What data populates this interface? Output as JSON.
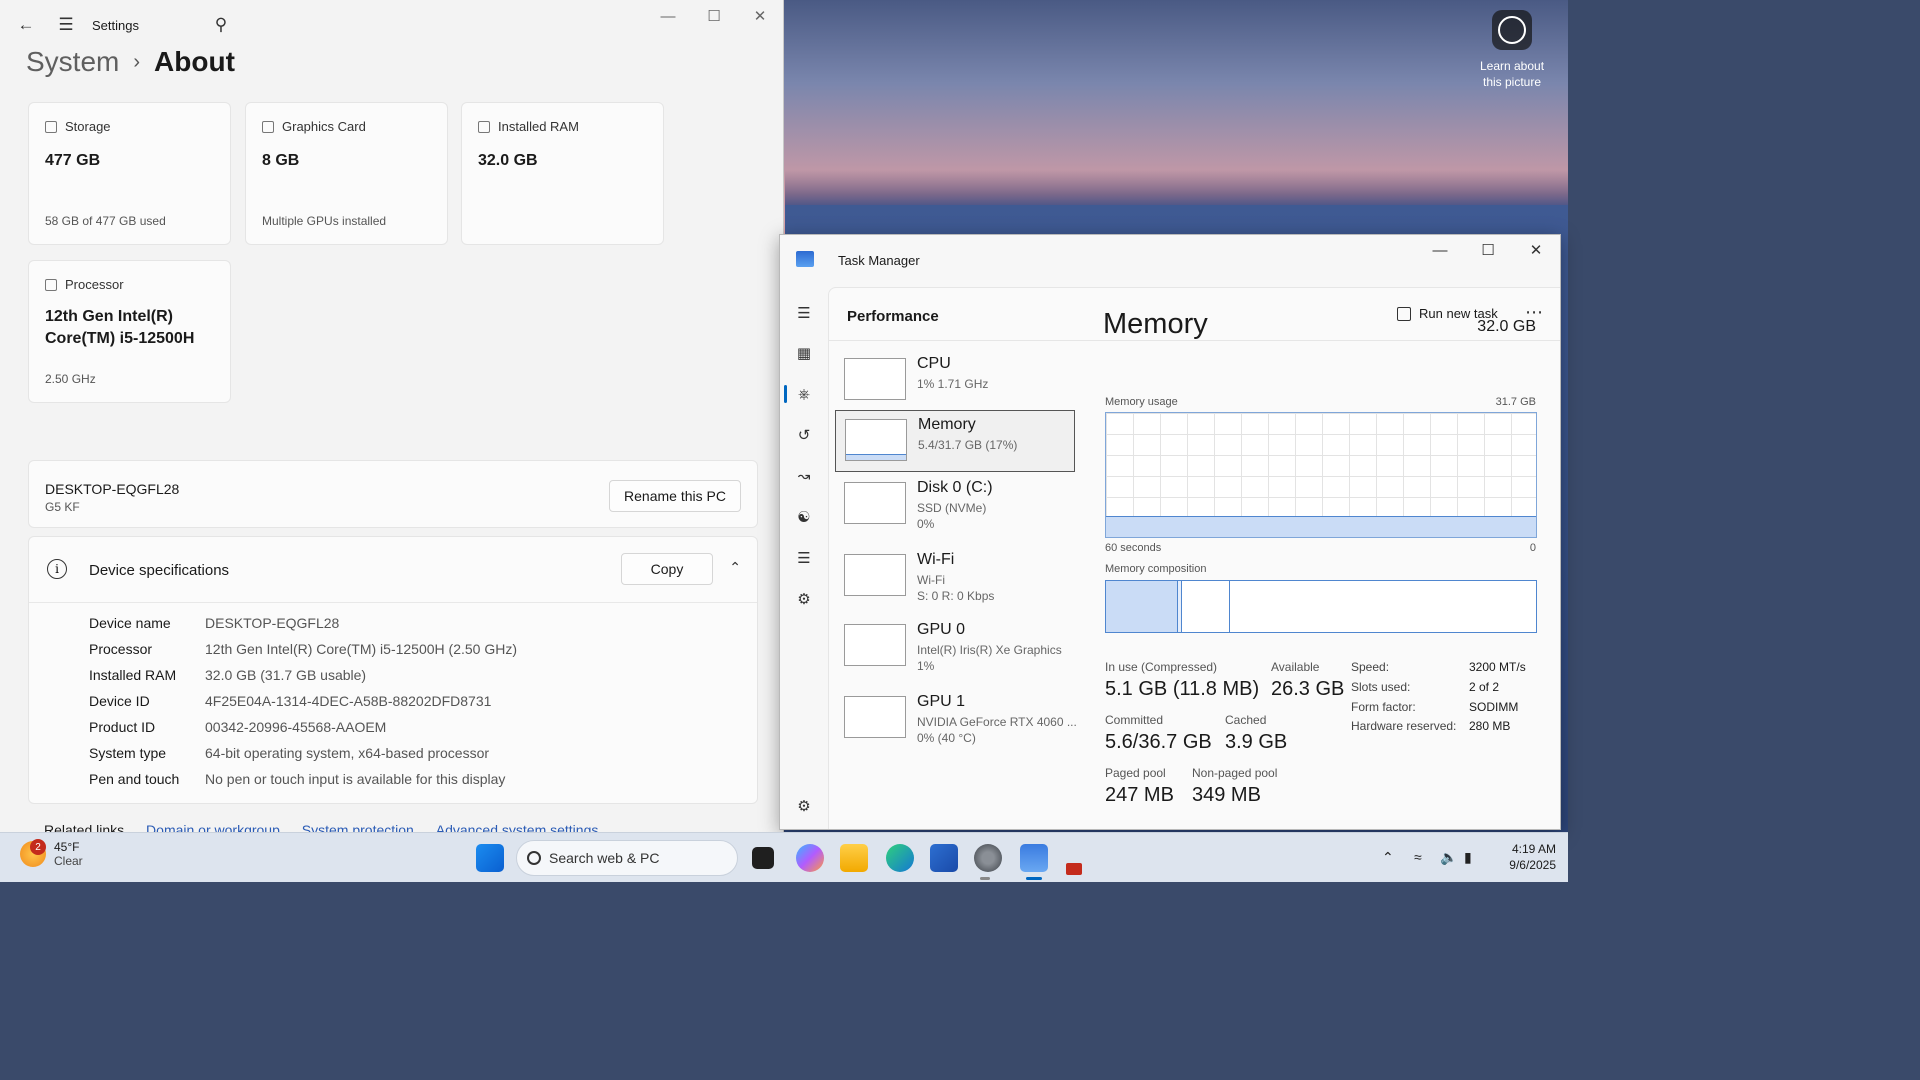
{
  "wallpaper": {
    "learn_line1": "Learn about",
    "learn_line2": "this picture"
  },
  "settings": {
    "title": "Settings",
    "breadcrumb": {
      "parent": "System",
      "current": "About"
    },
    "cards": {
      "storage": {
        "label": "Storage",
        "value": "477 GB",
        "sub": "58 GB of 477 GB used"
      },
      "graphics": {
        "label": "Graphics Card",
        "value": "8 GB",
        "sub": "Multiple GPUs installed"
      },
      "ram": {
        "label": "Installed RAM",
        "value": "32.0 GB"
      },
      "processor": {
        "label": "Processor",
        "value_line1": "12th Gen Intel(R)",
        "value_line2": "Core(TM) i5-12500H",
        "sub": "2.50 GHz"
      }
    },
    "pc": {
      "name": "DESKTOP-EQGFL28",
      "model": "G5 KF",
      "rename_label": "Rename this PC"
    },
    "specs": {
      "title": "Device specifications",
      "copy_label": "Copy",
      "rows": [
        {
          "k": "Device name",
          "v": "DESKTOP-EQGFL28"
        },
        {
          "k": "Processor",
          "v": "12th Gen Intel(R) Core(TM) i5-12500H (2.50 GHz)"
        },
        {
          "k": "Installed RAM",
          "v": "32.0 GB (31.7 GB usable)"
        },
        {
          "k": "Device ID",
          "v": "4F25E04A-1314-4DEC-A58B-88202DFD8731"
        },
        {
          "k": "Product ID",
          "v": "00342-20996-45568-AAOEM"
        },
        {
          "k": "System type",
          "v": "64-bit operating system, x64-based processor"
        },
        {
          "k": "Pen and touch",
          "v": "No pen or touch input is available for this display"
        }
      ]
    },
    "related": {
      "label": "Related links",
      "links": [
        "Domain or workgroup",
        "System protection",
        "Advanced system settings"
      ]
    }
  },
  "taskmgr": {
    "title": "Task Manager",
    "section": "Performance",
    "run_new_task": "Run new task",
    "resources": [
      {
        "name": "CPU",
        "l2": "1% 1.71 GHz",
        "l3": ""
      },
      {
        "name": "Memory",
        "l2": "5.4/31.7 GB (17%)",
        "l3": ""
      },
      {
        "name": "Disk 0 (C:)",
        "l2": "SSD (NVMe)",
        "l3": "0%"
      },
      {
        "name": "Wi-Fi",
        "l2": "Wi-Fi",
        "l3": "S: 0 R: 0 Kbps"
      },
      {
        "name": "GPU 0",
        "l2": "Intel(R) Iris(R) Xe Graphics",
        "l3": "1%"
      },
      {
        "name": "GPU 1",
        "l2": "NVIDIA GeForce RTX 4060 ...",
        "l3": "0% (40 °C)"
      }
    ],
    "memory": {
      "title": "Memory",
      "total": "32.0 GB",
      "usage_label": "Memory usage",
      "usage_max": "31.7 GB",
      "time_left": "60 seconds",
      "time_right": "0",
      "usage_fraction": 0.17,
      "composition_label": "Memory composition",
      "in_use_label": "In use (Compressed)",
      "in_use": "5.1 GB (11.8 MB)",
      "available_label": "Available",
      "available": "26.3 GB",
      "committed_label": "Committed",
      "committed": "5.6/36.7 GB",
      "cached_label": "Cached",
      "cached": "3.9 GB",
      "paged_label": "Paged pool",
      "paged": "247 MB",
      "nonpaged_label": "Non-paged pool",
      "nonpaged": "349 MB",
      "details": [
        {
          "k": "Speed:",
          "v": "3200 MT/s"
        },
        {
          "k": "Slots used:",
          "v": "2 of 2"
        },
        {
          "k": "Form factor:",
          "v": "SODIMM"
        },
        {
          "k": "Hardware reserved:",
          "v": "280 MB"
        }
      ]
    }
  },
  "taskbar": {
    "temp": "45°F",
    "condition": "Clear",
    "badge": "2",
    "search_placeholder": "Search web & PC",
    "time": "4:19 AM",
    "date": "9/6/2025"
  }
}
